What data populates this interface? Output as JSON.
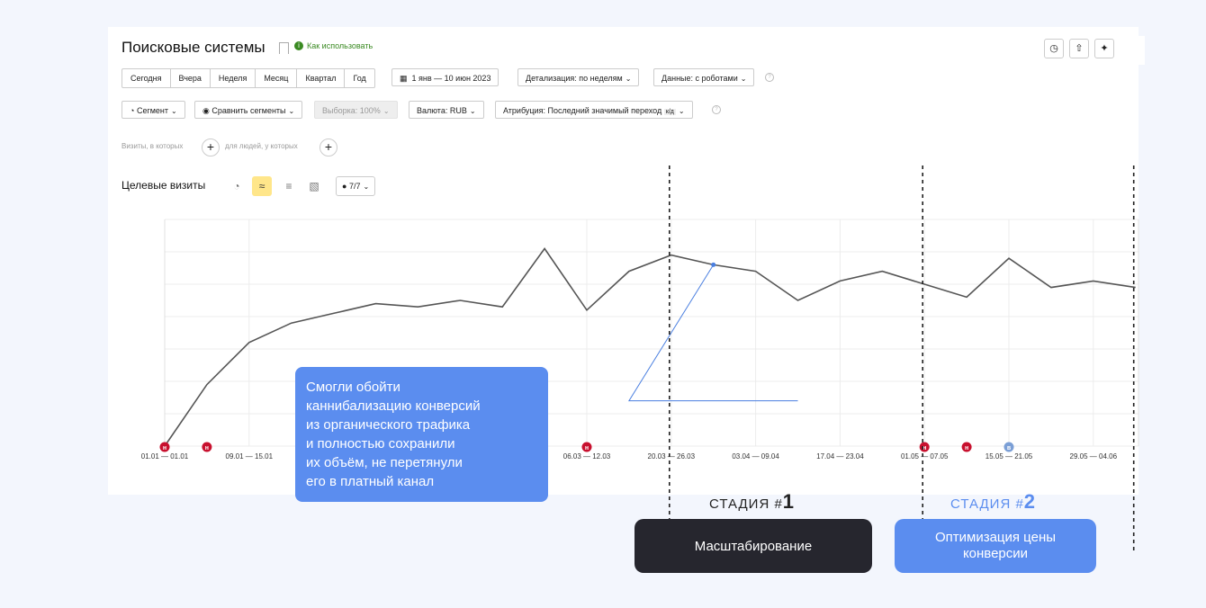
{
  "header": {
    "title": "Поисковые системы",
    "how_to": "Как использовать"
  },
  "toolbar": {
    "periods": [
      "Сегодня",
      "Вчера",
      "Неделя",
      "Месяц",
      "Квартал",
      "Год"
    ],
    "date_range": "1 янв — 10 июн 2023",
    "detail": "Детализация: по неделям",
    "data": "Данные: с роботами"
  },
  "filters": {
    "segment": "Сегмент",
    "compare": "Сравнить сегменты",
    "sample": "Выборка: 100%",
    "currency": "Валюта: RUB",
    "attribution": "Атрибуция: Последний значимый переход",
    "attribution_badge": "к/д"
  },
  "visits_row": {
    "visits_which": "Визиты, в которых",
    "people_which": "для людей, у которых"
  },
  "chart_header": {
    "title": "Целевые визиты",
    "series_count": "7/7"
  },
  "chart_data": {
    "type": "line",
    "x": [
      "01.01 — 01.01",
      "02.01 — 08.01",
      "09.01 — 15.01",
      "16.01 — 22.01",
      "23.01 — 29.01",
      "30.01 — 05.02",
      "06.02 — 12.02",
      "13.02 — 19.02",
      "20.02 — 26.02",
      "27.02 — 05.03",
      "06.03 — 12.03",
      "13.03 — 19.03",
      "20.03 — 26.03",
      "27.03 — 02.04",
      "03.04 — 09.04",
      "10.04 — 16.04",
      "17.04 — 23.04",
      "24.04 — 30.04",
      "01.05 — 07.05",
      "08.05 — 14.05",
      "15.05 — 21.05",
      "22.05 — 28.05",
      "29.05 — 04.06",
      "05.06 — 10.06"
    ],
    "tick_labels": [
      "01.01 — 01.01",
      "09.01 — 15.01",
      "06.03 — 12.03",
      "20.03 — 26.03",
      "03.04 — 09.04",
      "17.04 — 23.04",
      "01.05 — 07.05",
      "15.05 — 21.05",
      "29.05 — 04.06"
    ],
    "series": [
      {
        "values": [
          0,
          19,
          32,
          38,
          41,
          44,
          43,
          45,
          43,
          61,
          42,
          54,
          59,
          56,
          54,
          45,
          51,
          54,
          50,
          46,
          58,
          49,
          51,
          49
        ],
        "color": "#555555"
      }
    ],
    "annotation_line": {
      "color": "#4a7fe0",
      "points": [
        [
          "10.04 — 16.04",
          14
        ],
        [
          "13.03 — 19.03",
          14
        ],
        [
          "27.03 — 02.04",
          56
        ]
      ]
    },
    "ylim": [
      0,
      70
    ],
    "grid": true,
    "event_markers": [
      {
        "x": "01.01 — 01.01",
        "label": "н",
        "color": "#c8102e"
      },
      {
        "x": "02.01 — 08.01",
        "label": "н",
        "color": "#c8102e"
      },
      {
        "x": "06.03 — 12.03",
        "label": "н",
        "color": "#c8102e"
      },
      {
        "x": "01.05 — 07.05",
        "label": "н",
        "color": "#c8102e"
      },
      {
        "x": "08.05 — 14.05",
        "label": "н",
        "color": "#c8102e"
      },
      {
        "x": "15.05 — 21.05",
        "label": "в",
        "color": "#7b9fd6"
      }
    ],
    "stage_dividers": [
      "20.03 — 26.03",
      "01.05 — 07.05",
      "05.06 — 10.06"
    ]
  },
  "callout": {
    "text": "Смогли обойти\nканнибализацию конверсий\nиз органического трафика\nи полностью сохранили\nих объём, не перетянули\nего в платный канал"
  },
  "stages": {
    "stage1_label": "СТАДИЯ #",
    "stage1_num": "1",
    "stage1_name": "Масштабирование",
    "stage2_label": "СТАДИЯ #",
    "stage2_num": "2",
    "stage2_name": "Оптимизация цены\nконверсии"
  },
  "colors": {
    "accent": "#5b8def",
    "dark_pill": "#26262e",
    "marker": "#c8102e"
  }
}
